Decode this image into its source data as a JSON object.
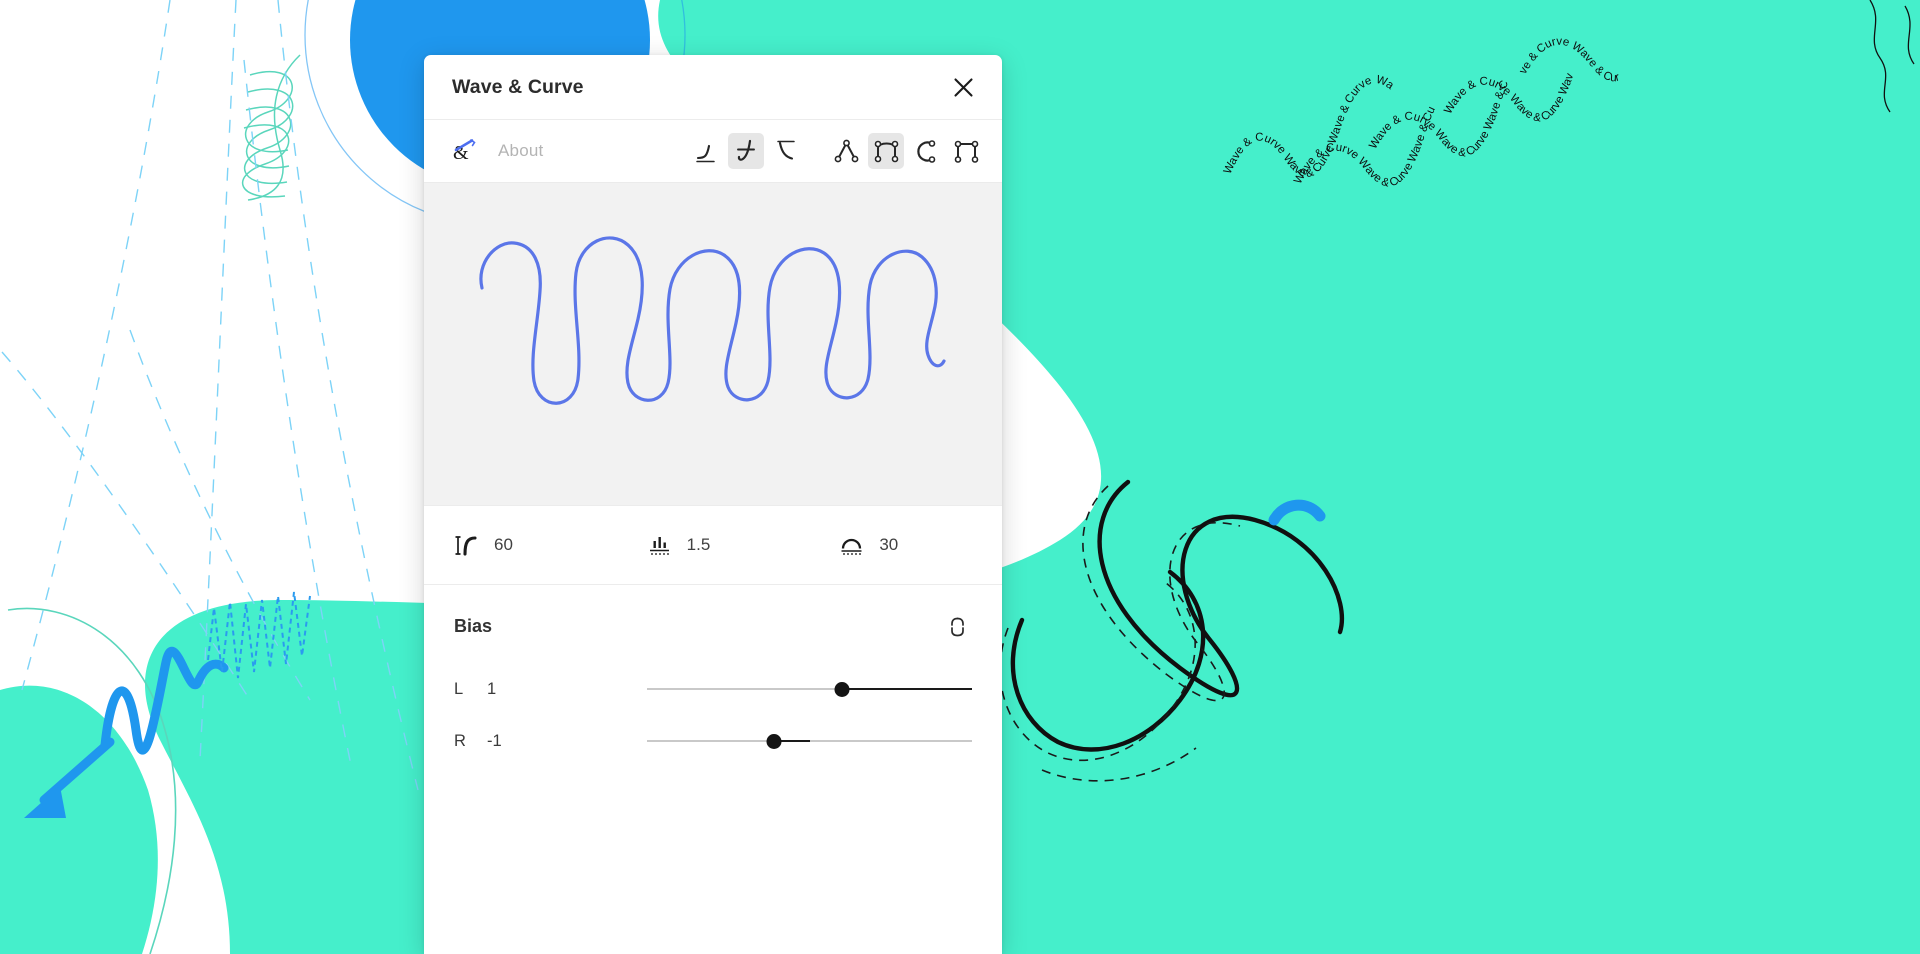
{
  "window": {
    "title": "Wave & Curve",
    "close_icon": "close-icon"
  },
  "toolbar": {
    "brand_icon": "ampersand-pen-logo-icon",
    "about_label": "About",
    "wave_tools": [
      {
        "id": "wave-smooth",
        "icon": "curve-ease-out-icon",
        "active": false
      },
      {
        "id": "wave-zigzag",
        "icon": "curve-crossed-icon",
        "active": true
      },
      {
        "id": "wave-arc",
        "icon": "curve-ease-in-icon",
        "active": false
      }
    ],
    "node_tools": [
      {
        "id": "node-corner",
        "icon": "path-corner-node-icon",
        "active": false
      },
      {
        "id": "node-smooth",
        "icon": "path-smooth-node-icon",
        "active": true
      },
      {
        "id": "node-round",
        "icon": "path-round-node-icon",
        "active": false
      },
      {
        "id": "node-square",
        "icon": "path-square-node-icon",
        "active": false
      }
    ]
  },
  "preview": {
    "background": "#f2f2f2",
    "stroke_color": "#5b76e8",
    "stroke_width": 3.2,
    "description": "serpentine-wave-preview"
  },
  "params": [
    {
      "id": "wavelength",
      "icon": "wavelength-icon",
      "value": "60"
    },
    {
      "id": "amplitude",
      "icon": "amplitude-icon",
      "value": "1.5"
    },
    {
      "id": "angle",
      "icon": "protractor-icon",
      "value": "30"
    }
  ],
  "bias": {
    "title": "Bias",
    "link_icon": "link-toggle-icon",
    "sliders": [
      {
        "id": "bias-left",
        "label": "L",
        "value": "1",
        "min": -2,
        "max": 2,
        "percent": 60
      },
      {
        "id": "bias-right",
        "label": "R",
        "value": "-1",
        "min": -2,
        "max": 2,
        "percent": 39
      }
    ]
  },
  "background": {
    "teal": "#45efcb",
    "blue": "#1f97ee",
    "light_blue_dash": "#7dd3f7",
    "mint_stroke": "#5ad6bc",
    "black_stroke": "#101010",
    "wave_text": "Wave & Curve"
  }
}
